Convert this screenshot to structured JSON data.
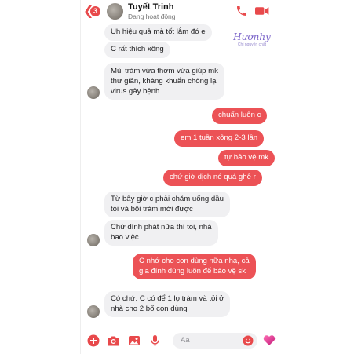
{
  "header": {
    "unread_badge": "3",
    "contact_name": "Tuyết Trinh",
    "status": "Đang hoạt động"
  },
  "watermark": {
    "main": "Hươnhy",
    "sub": "Chi nguyên chất"
  },
  "messages": [
    {
      "dir": "in",
      "lines": [
        "Uh hiệu quả mà tốt lắm đó e"
      ]
    },
    {
      "dir": "in",
      "lines": [
        "C rất thích xông"
      ]
    },
    {
      "dir": "in",
      "lines": [
        "Mùi tràm vừa thơm vừa giúp mk",
        "thư giãn, kháng khuẩn chóng lại",
        "virus gây bệnh"
      ]
    },
    {
      "dir": "out",
      "lines": [
        "chuẩn luôn c"
      ]
    },
    {
      "dir": "out",
      "lines": [
        "em 1 tuần xông 2-3 lần"
      ]
    },
    {
      "dir": "out",
      "lines": [
        "tự bảo vệ mk"
      ]
    },
    {
      "dir": "out",
      "lines": [
        "chứ giờ dịch nó quá ghê r"
      ]
    },
    {
      "dir": "in",
      "lines": [
        "Từ bây giờ c phải chăm uống dầu",
        "tỏi và bôi tràm mới được"
      ]
    },
    {
      "dir": "in",
      "lines": [
        "Chứ dính phát nữa thì toi, nhà",
        "bao việc"
      ]
    },
    {
      "dir": "out",
      "lines": [
        "C nhớ cho con dùng nữa nha, cả",
        "gia đình dùng luôn để bảo vệ sk"
      ]
    },
    {
      "dir": "in",
      "lines": [
        "Có chứ. C có để 1 lọ tràm và tỏi ở",
        "nhà cho 2 bố con dùng"
      ]
    }
  ],
  "composer": {
    "placeholder": "Aa"
  },
  "colors": {
    "accent": "#e8494b",
    "outgoing_bubble": "#ec5256",
    "incoming_bubble": "#f0f0f2"
  },
  "icons": [
    "back-chevron-icon",
    "phone-icon",
    "video-icon",
    "plus-icon",
    "camera-icon",
    "image-icon",
    "mic-icon",
    "emoji-icon",
    "heart-icon"
  ]
}
